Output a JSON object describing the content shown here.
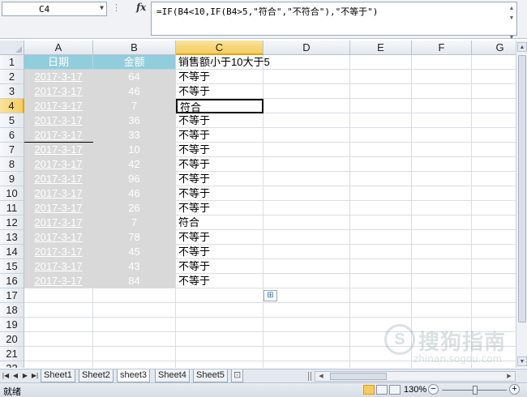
{
  "formula_bar": {
    "name_box": "C4",
    "fx_label": "fx",
    "formula": "=IF(B4<10,IF(B4>5,\"符合\",\"不符合\"),\"不等于\")"
  },
  "columns": [
    "A",
    "B",
    "C",
    "D",
    "E",
    "F",
    "G"
  ],
  "selected_column": "C",
  "selected_row": "4",
  "rows": [
    "1",
    "2",
    "3",
    "4",
    "5",
    "6",
    "7",
    "8",
    "9",
    "10",
    "11",
    "12",
    "13",
    "14",
    "15",
    "16",
    "17",
    "18",
    "19",
    "20",
    "21",
    "22"
  ],
  "table": {
    "header_date": "日期",
    "header_amount": "金额",
    "c1_label": "销售额小于10大于5",
    "dates": [
      "2017-3-17",
      "2017-3-17",
      "2017-3-17",
      "2017-3-17",
      "2017-3-17",
      "2017-3-17",
      "2017-3-17",
      "2017-3-17",
      "2017-3-17",
      "2017-3-17",
      "2017-3-17",
      "2017-3-17",
      "2017-3-17",
      "2017-3-17",
      "2017-3-17"
    ],
    "amounts": [
      "64",
      "46",
      "7",
      "36",
      "33",
      "10",
      "42",
      "96",
      "46",
      "26",
      "7",
      "78",
      "45",
      "43",
      "84"
    ],
    "results": [
      "不等于",
      "不等于",
      "符合",
      "不等于",
      "不等于",
      "不等于",
      "不等于",
      "不等于",
      "不等于",
      "不等于",
      "符合",
      "不等于",
      "不等于",
      "不等于",
      "不等于"
    ]
  },
  "sheets": [
    "Sheet1",
    "Sheet2",
    "sheet3",
    "Sheet4",
    "Sheet5"
  ],
  "active_sheet": "sheet3",
  "status": {
    "ready": "就绪",
    "zoom": "130%"
  },
  "watermark": {
    "logo": "S",
    "text": "搜狗指南",
    "url": "zhinan.sogou.com"
  },
  "colors": {
    "header_fill": "#92cddc",
    "data_fill": "#d9d9d9",
    "selection_highlight": "#f5cc60"
  }
}
